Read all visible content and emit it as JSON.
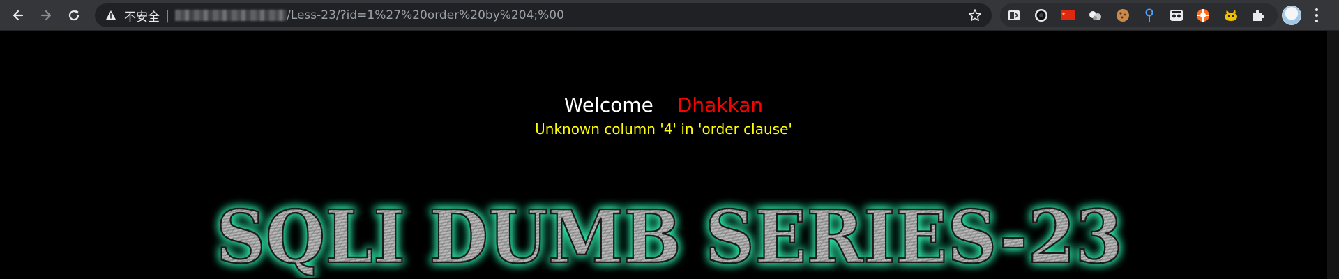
{
  "browser": {
    "security_label": "不安全",
    "url_path": "/Less-23/?id=1%27%20order%20by%204;%00",
    "icons": {
      "back": "back-arrow-icon",
      "forward": "forward-arrow-icon",
      "reload": "reload-icon",
      "warning": "warning-triangle-icon",
      "bookmark": "star-icon",
      "extensions": "puzzle-icon",
      "menu": "more-vert-icon"
    }
  },
  "page": {
    "welcome": "Welcome",
    "user": "Dhakkan",
    "error": "Unknown column '4' in 'order clause'",
    "banner": "SQLI DUMB SERIES-23",
    "colors": {
      "background": "#000000",
      "welcome": "#ffffff",
      "user": "#ff0000",
      "error": "#ffff00",
      "banner_glow": "#2ee6a6"
    }
  }
}
